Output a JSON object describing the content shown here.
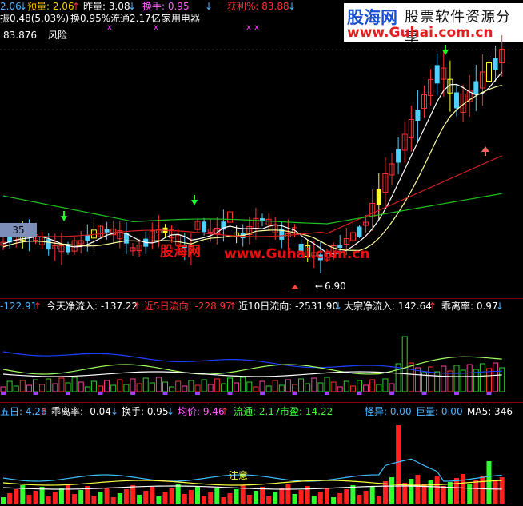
{
  "header": {
    "row1": [
      {
        "text": "2.06",
        "color": "#4fb4ff"
      },
      {
        "text": "↓",
        "color": "#4fb4ff"
      },
      {
        "text": "预量: 2.06",
        "color": "#ffcc00"
      },
      {
        "text": "↑",
        "color": "#ff3030"
      },
      {
        "text": "昨量: 3.08",
        "color": "#ffffff"
      },
      {
        "text": "↓",
        "color": "#4fb4ff"
      },
      {
        "text": "换手: 0.95",
        "color": "#ff60ff"
      },
      {
        "text": "↓",
        "color": "#4fb4ff"
      },
      {
        "text": "获利%: 83.88",
        "color": "#ff3030"
      },
      {
        "text": "↓",
        "color": "#4fb4ff"
      }
    ],
    "row2": [
      {
        "text": "振0.48(5.03%)",
        "color": "#ffffff"
      },
      {
        "text": "换0.95%",
        "color": "#ffffff"
      },
      {
        "text": "流通2.17亿",
        "color": "#ffffff"
      },
      {
        "text": "家用电器",
        "color": "#ffffff"
      }
    ],
    "row3": [
      {
        "text": "83.876",
        "color": "#ffffff"
      },
      {
        "text": "风险",
        "color": "#ffffff"
      }
    ],
    "marker_x": "x"
  },
  "logo": {
    "name": "股海网",
    "slogan": "股票软件资源分享",
    "url": "www.Guhai.com.cn"
  },
  "watermark": {
    "name": "股海网",
    "url": "www.Guhai.com.cn"
  },
  "main_chart": {
    "price_box": "35",
    "low_label": "6.90",
    "low_arrow": "←"
  },
  "panel2": {
    "items": [
      {
        "text": "-122.91",
        "color": "#4fb4ff"
      },
      {
        "text": "↑",
        "color": "#ff3030"
      },
      {
        "text": "今天净流入: -137.22",
        "color": "#ffffff"
      },
      {
        "text": "↑",
        "color": "#ff3030"
      },
      {
        "text": "近5日流向: -228.97",
        "color": "#ff3030"
      },
      {
        "text": "↑",
        "color": "#ff3030"
      },
      {
        "text": "近10日流向: -2531.90",
        "color": "#ffffff"
      },
      {
        "text": "↓",
        "color": "#4fb4ff"
      },
      {
        "text": "大宗净流入: 142.64",
        "color": "#ffffff"
      },
      {
        "text": "↑",
        "color": "#ff3030"
      },
      {
        "text": "乖离率: 0.97",
        "color": "#ffffff"
      },
      {
        "text": "↓",
        "color": "#4fb4ff"
      }
    ]
  },
  "panel3": {
    "items": [
      {
        "text": "五日: 4.26",
        "color": "#4fb4ff"
      },
      {
        "text": "↑",
        "color": "#ff3030"
      },
      {
        "text": "乖离率: -0.04",
        "color": "#ffffff"
      },
      {
        "text": "↓",
        "color": "#4fb4ff"
      },
      {
        "text": "换手: 0.95",
        "color": "#ffffff"
      },
      {
        "text": "↓",
        "color": "#4fb4ff"
      },
      {
        "text": "均价: 9.46",
        "color": "#ff60ff"
      },
      {
        "text": "↑",
        "color": "#ff3030"
      },
      {
        "text": "流通: 2.17",
        "color": "#40ff40"
      },
      {
        "text": "市盈: 14.22",
        "color": "#40ff40"
      },
      {
        "text": "怪异: 0.00",
        "color": "#4fb4ff"
      },
      {
        "text": "巨量: 0.00",
        "color": "#4fb4ff"
      },
      {
        "text": "MA5: 346",
        "color": "#ffffff"
      }
    ],
    "note_label": "注意"
  }
}
